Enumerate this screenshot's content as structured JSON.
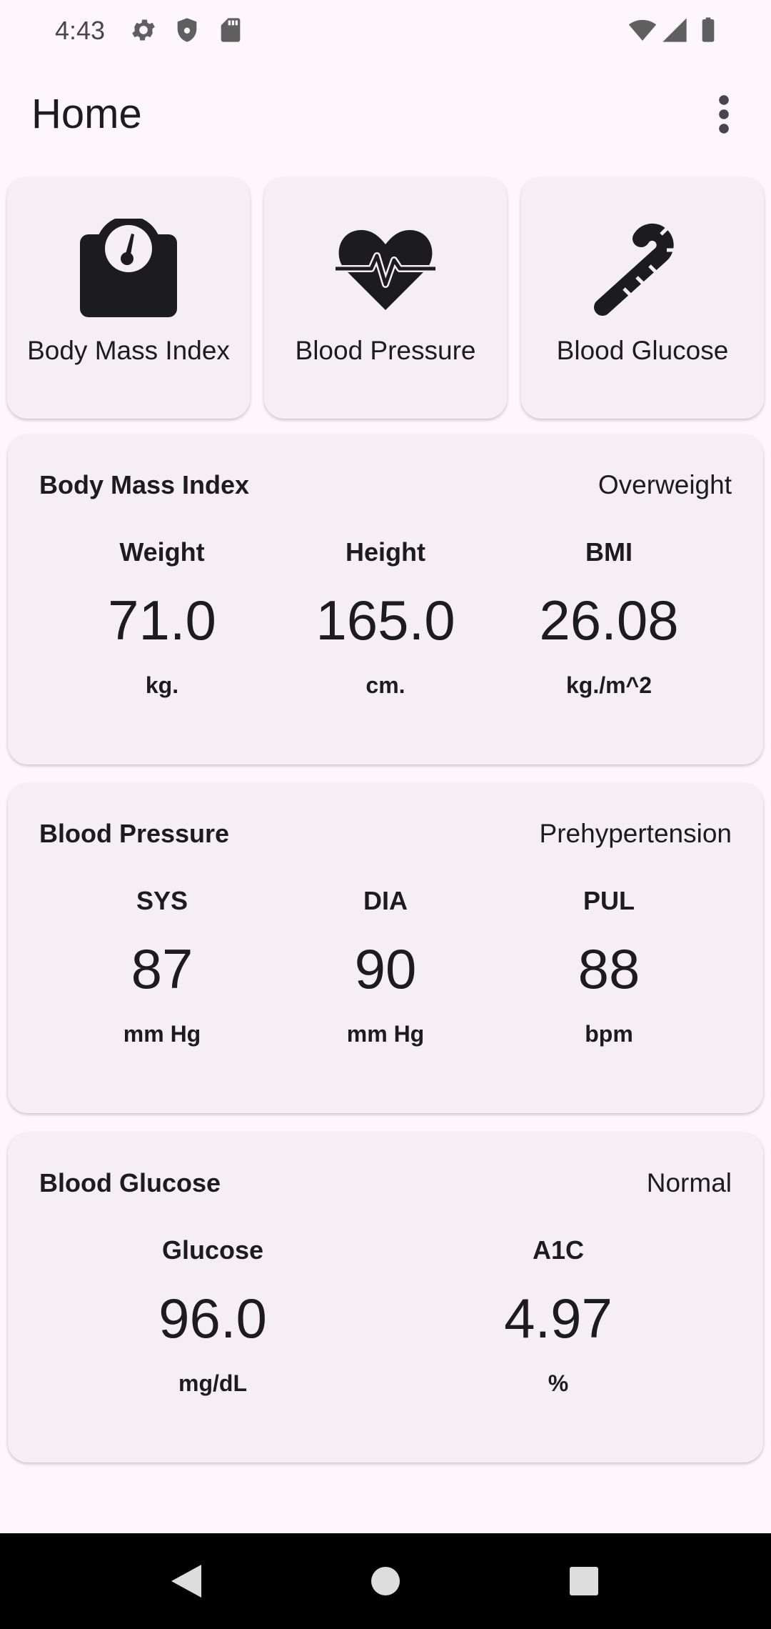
{
  "status_bar": {
    "time": "4:43",
    "icons": [
      "gear-icon",
      "shield-icon",
      "sd-card-icon",
      "wifi-icon",
      "signal-icon",
      "battery-icon"
    ]
  },
  "app_bar": {
    "title": "Home",
    "menu_icon": "more-vert-icon"
  },
  "tiles": [
    {
      "label": "Body Mass Index",
      "icon": "scale-icon"
    },
    {
      "label": "Blood Pressure",
      "icon": "heart-pulse-icon"
    },
    {
      "label": "Blood Glucose",
      "icon": "candy-cane-icon"
    }
  ],
  "cards": {
    "bmi": {
      "title": "Body Mass Index",
      "status": "Overweight",
      "metrics": [
        {
          "label": "Weight",
          "value": "71.0",
          "unit": "kg."
        },
        {
          "label": "Height",
          "value": "165.0",
          "unit": "cm."
        },
        {
          "label": "BMI",
          "value": "26.08",
          "unit": "kg./m^2"
        }
      ]
    },
    "bp": {
      "title": "Blood Pressure",
      "status": "Prehypertension",
      "metrics": [
        {
          "label": "SYS",
          "value": "87",
          "unit": "mm Hg"
        },
        {
          "label": "DIA",
          "value": "90",
          "unit": "mm Hg"
        },
        {
          "label": "PUL",
          "value": "88",
          "unit": "bpm"
        }
      ]
    },
    "glucose": {
      "title": "Blood Glucose",
      "status": "Normal",
      "metrics": [
        {
          "label": "Glucose",
          "value": "96.0",
          "unit": "mg/dL"
        },
        {
          "label": "A1C",
          "value": "4.97",
          "unit": "%"
        }
      ]
    }
  },
  "nav_bar": {
    "buttons": [
      "back-icon",
      "home-icon",
      "recents-icon"
    ]
  }
}
